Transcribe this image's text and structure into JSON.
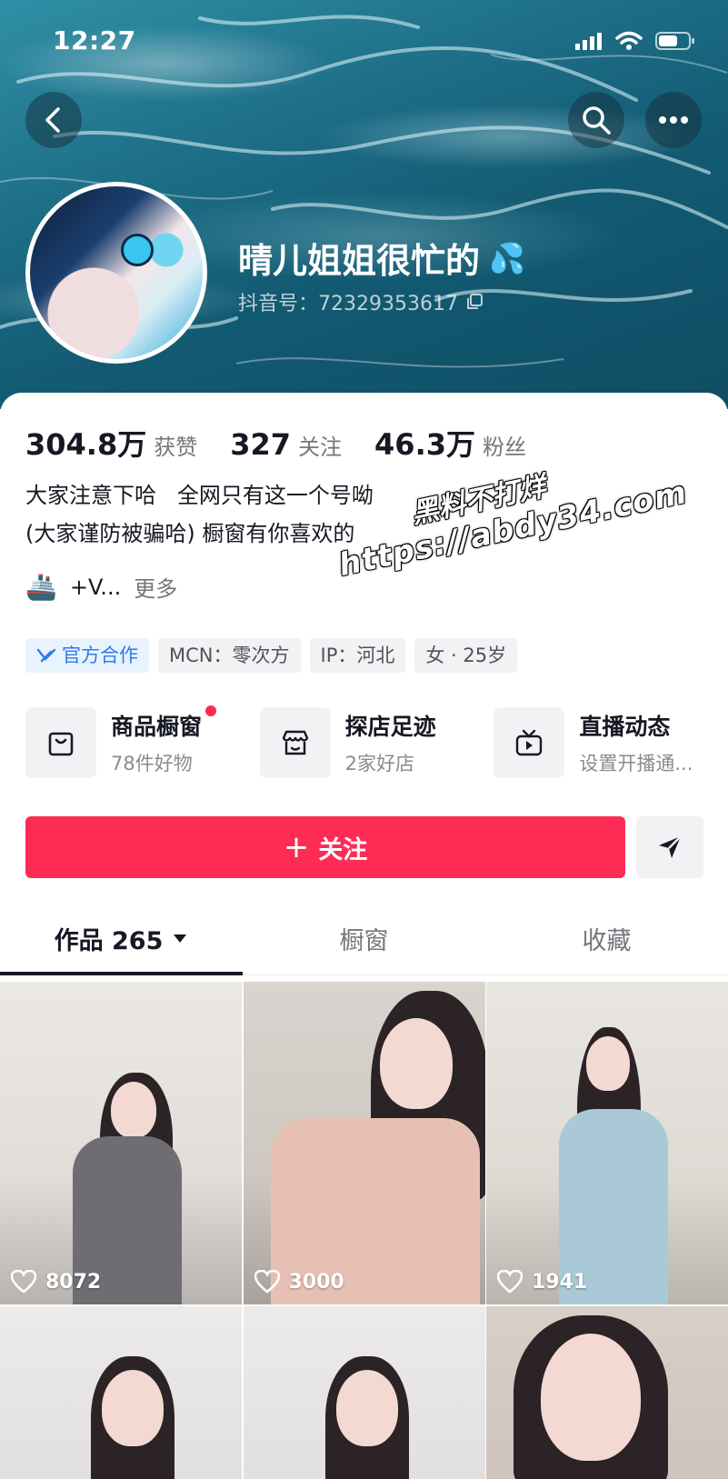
{
  "status_bar": {
    "time": "12:27"
  },
  "header": {
    "nickname": "晴儿姐姐很忙的",
    "nickname_emoji": "💦",
    "account_id": "抖音号：72329353617"
  },
  "stats": [
    {
      "value": "304.8万",
      "label": "获赞"
    },
    {
      "value": "327",
      "label": "关注"
    },
    {
      "value": "46.3万",
      "label": "粉丝"
    }
  ],
  "bio": {
    "line1": "大家注意下哈   全网只有这一个号呦",
    "line2": "(大家谨防被骗哈) 橱窗有你喜欢的"
  },
  "extra": {
    "emoji": "🚢",
    "text": "+V...",
    "more": "更多"
  },
  "tags": {
    "official": "官方合作",
    "mcn": "MCN：零次方",
    "ip": "IP：河北",
    "profile": "女 · 25岁"
  },
  "features": [
    {
      "title": "商品橱窗",
      "sub": "78件好物"
    },
    {
      "title": "探店足迹",
      "sub": "2家好店"
    },
    {
      "title": "直播动态",
      "sub": "设置开播通..."
    }
  ],
  "follow_button": {
    "plus": "+",
    "label": "关注"
  },
  "tabs": [
    {
      "label": "作品 265"
    },
    {
      "label": "橱窗"
    },
    {
      "label": "收藏"
    }
  ],
  "videos": [
    {
      "likes": "8072"
    },
    {
      "likes": "3000"
    },
    {
      "likes": "1941"
    }
  ],
  "watermark": {
    "line1": "黑料不打烊",
    "line2": "https://abdy34.com"
  },
  "colors": {
    "brand_red": "#fe2c55",
    "official_blue": "#2b7ce9",
    "text_primary": "#161823",
    "text_secondary": "#75767c"
  }
}
